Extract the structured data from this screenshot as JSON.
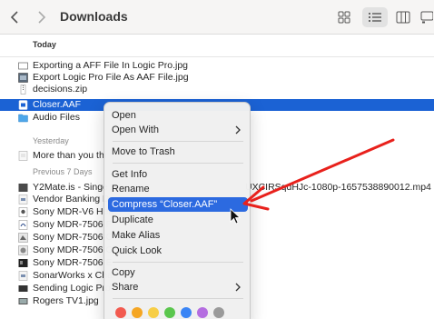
{
  "window": {
    "title": "Downloads",
    "back_icon": "chevron-left-icon",
    "forward_icon": "chevron-right-icon"
  },
  "toolbar": {
    "views": [
      "icon-grid-icon",
      "list-view-icon",
      "column-view-icon",
      "gallery-view-icon"
    ]
  },
  "sections": {
    "today": "Today",
    "yesterday": "Yesterday",
    "previous7": "Previous 7 Days"
  },
  "files": {
    "today": [
      {
        "name": "Exporting a AFF File In Logic Pro.jpg"
      },
      {
        "name": "Export Logic Pro File As AAF File.jpg"
      },
      {
        "name": "decisions.zip"
      },
      {
        "name": "Closer.AAF",
        "selected": true
      },
      {
        "name": "Audio Files"
      }
    ],
    "yesterday": [
      {
        "name": "More than you thi"
      }
    ],
    "previous7": [
      {
        "name": "Y2Mate.is - Singe",
        "suffix": "UXCIRSqdHJc-1080p-1657538890012.mp4"
      },
      {
        "name": "Vendor Banking D"
      },
      {
        "name": "Sony MDR-V6 Hea"
      },
      {
        "name": "Sony MDR-7506 F"
      },
      {
        "name": "Sony MDR-7506 C"
      },
      {
        "name": "Sony MDR-7506 C"
      },
      {
        "name": "Sony MDR-7506 E"
      },
      {
        "name": "SonarWorks x Cha"
      },
      {
        "name": "Sending Logic Pro"
      },
      {
        "name": "Rogers TV1.jpg"
      }
    ]
  },
  "context_menu": {
    "items": [
      {
        "label": "Open"
      },
      {
        "label": "Open With",
        "submenu": true
      },
      {
        "label": "Move to Trash"
      },
      {
        "label": "Get Info"
      },
      {
        "label": "Rename"
      },
      {
        "label": "Compress “Closer.AAF”",
        "highlighted": true
      },
      {
        "label": "Duplicate"
      },
      {
        "label": "Make Alias"
      },
      {
        "label": "Quick Look"
      },
      {
        "label": "Copy"
      },
      {
        "label": "Share",
        "submenu": true
      }
    ],
    "tag_colors": [
      "#f25a4f",
      "#f5a623",
      "#f7ce46",
      "#5ac64d",
      "#3a85f5",
      "#b46de0",
      "#9a9a9a"
    ]
  },
  "colors": {
    "selection": "#1b62d4",
    "menu_highlight": "#2c6ae0",
    "annotation_arrow": "#e8211c"
  }
}
